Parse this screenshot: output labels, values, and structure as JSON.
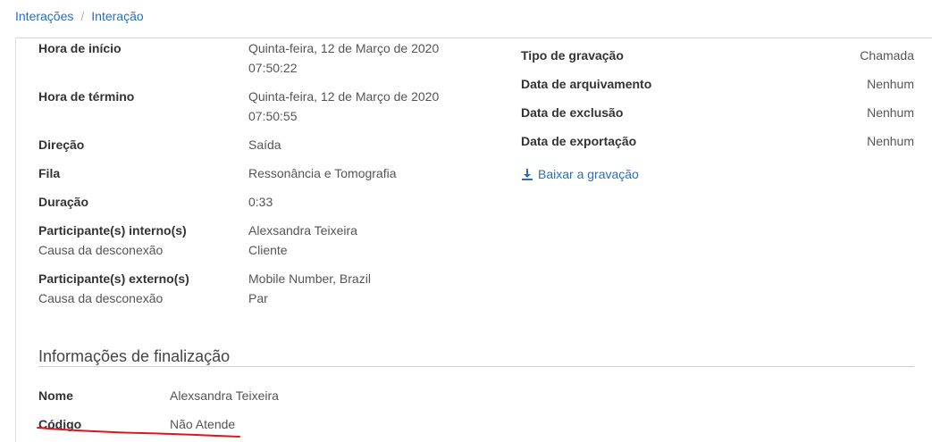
{
  "breadcrumb": {
    "items": [
      "Interações",
      "Interação"
    ],
    "separator": "/"
  },
  "details": [
    {
      "label": "Hora de início",
      "value_line1": "Quinta-feira, 12 de Março de 2020",
      "value_line2": "07:50:22"
    },
    {
      "label": "Hora de término",
      "value_line1": "Quinta-feira, 12 de Março de 2020",
      "value_line2": "07:50:55"
    },
    {
      "label": "Direção",
      "value": "Saída"
    },
    {
      "label": "Fila",
      "value": "Ressonância e Tomografia"
    },
    {
      "label": "Duração",
      "value": "0:33"
    },
    {
      "label": "Participante(s) interno(s)",
      "value": "Alexsandra Teixeira",
      "sub_label": "Causa da desconexão",
      "sub_value": "Cliente"
    },
    {
      "label": "Participante(s) externo(s)",
      "value": "Mobile Number, Brazil",
      "sub_label": "Causa da desconexão",
      "sub_value": "Par"
    }
  ],
  "recording": [
    {
      "label": "Tipo de gravação",
      "value": "Chamada"
    },
    {
      "label": "Data de arquivamento",
      "value": "Nenhum"
    },
    {
      "label": "Data de exclusão",
      "value": "Nenhum"
    },
    {
      "label": "Data de exportação",
      "value": "Nenhum"
    }
  ],
  "download": {
    "label": "Baixar a gravação",
    "icon": "download-icon",
    "color": "#2a6ebb"
  },
  "wrapup": {
    "title": "Informações de finalização",
    "fields": [
      {
        "label": "Nome",
        "value": "Alexsandra Teixeira"
      },
      {
        "label": "Código",
        "value": "Não Atende"
      }
    ]
  },
  "colors": {
    "link": "#2a6ebb",
    "annotation": "#e0141e"
  }
}
